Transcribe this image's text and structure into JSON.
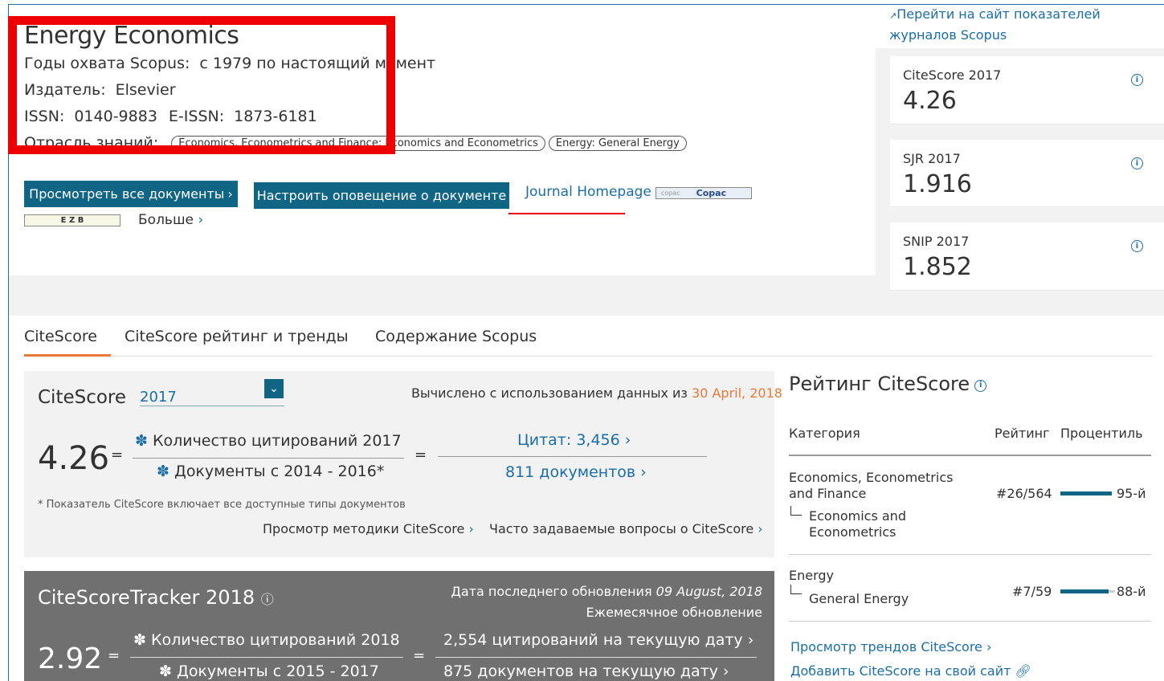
{
  "journal": {
    "title": "Energy Economics",
    "years_label": "Годы охвата Scopus:",
    "years_value": "с 1979 по настоящий момент",
    "publisher_label": "Издатель:",
    "publisher_value": "Elsevier",
    "issn_label": "ISSN:",
    "issn_value": "0140-9883",
    "eissn_label": "E-ISSN:",
    "eissn_value": "1873-6181",
    "subject_label": "Отрасль знаний:",
    "subjects": [
      "Economics, Econometrics and Finance: Economics and Econometrics",
      "Energy: General Energy"
    ]
  },
  "actions": {
    "view_all_docs": "Просмотреть все документы",
    "set_alert": "Настроить оповещение о документе",
    "journal_homepage": "Journal Homepage",
    "copac": "Copac",
    "ezb": "E Z B",
    "more": "Больше"
  },
  "scopus_metrics_link": "Перейти на сайт показателей журналов Scopus",
  "metrics": {
    "citescore_label": "CiteScore 2017",
    "citescore_value": "4.26",
    "sjr_label": "SJR 2017",
    "sjr_value": "1.916",
    "snip_label": "SNIP 2017",
    "snip_value": "1.852"
  },
  "tabs": [
    "CiteScore",
    "CiteScore рейтинг и тренды",
    "Содержание Scopus"
  ],
  "citescore": {
    "label": "CiteScore",
    "year": "2017",
    "calc_prefix": "Вычислено с использованием данных из",
    "calc_date": "30 April, 2018",
    "value": "4.26",
    "eq": "=",
    "numerator": "Количество цитирований 2017",
    "denominator": "Документы с 2014 - 2016*",
    "citations": "Цитат: 3,456",
    "documents": "811 документов",
    "note": "* Показатель CiteScore включает все доступные типы документов",
    "methodology": "Просмотр методики CiteScore",
    "faq": "Часто задаваемые вопросы о CiteScore"
  },
  "tracker": {
    "title": "CiteScoreTracker 2018",
    "updated_label": "Дата последнего обновления",
    "updated_date": "09 August, 2018",
    "monthly": "Ежемесячное обновление",
    "value": "2.92",
    "numerator": "Количество цитирований 2018",
    "denominator": "Документы с 2015 - 2017",
    "citations": "2,554 цитирований на текущую дату",
    "documents": "875 документов на текущую дату"
  },
  "ranking": {
    "title": "Рейтинг CiteScore",
    "col_category": "Категория",
    "col_rank": "Рейтинг",
    "col_percentile": "Процентиль",
    "rows": [
      {
        "category": "Economics, Econometrics and Finance",
        "subcategory": "Economics and Econometrics",
        "rank": "#26/564",
        "percentile": "95-й",
        "percentile_value": 95
      },
      {
        "category": "Energy",
        "subcategory": "General Energy",
        "rank": "#7/59",
        "percentile": "88-й",
        "percentile_value": 88
      }
    ],
    "trends_link": "Просмотр трендов CiteScore",
    "add_link": "Добавить CiteScore на свой сайт"
  },
  "colors": {
    "accent_blue": "#116584",
    "link": "#1a6ea8",
    "orange": "#e8793a",
    "annotation_red": "#ee0000"
  }
}
